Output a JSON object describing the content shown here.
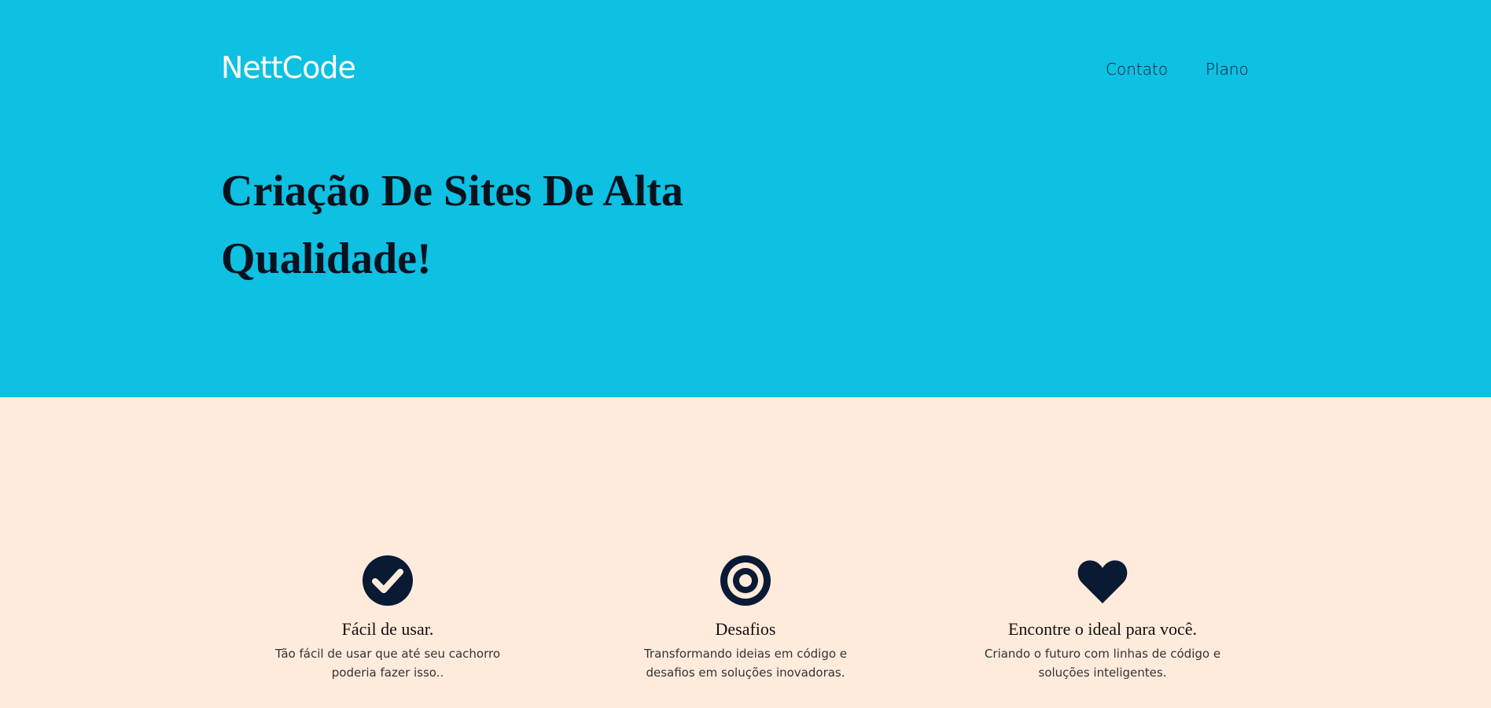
{
  "brand": {
    "name": "NettCode"
  },
  "nav": {
    "items": [
      "Contato",
      "Plano"
    ]
  },
  "hero": {
    "headline": "Criação De Sites De Alta Qualidade!"
  },
  "features": [
    {
      "icon": "check-circle-icon",
      "title": "Fácil de usar.",
      "text": "Tão fácil de usar que até seu cachorro poderia fazer isso.."
    },
    {
      "icon": "target-icon",
      "title": "Desafios",
      "text": "Transformando ideias em código e desafios em soluções inovadoras."
    },
    {
      "icon": "heart-icon",
      "title": "Encontre o ideal para você.",
      "text": "Criando o futuro com linhas de código e soluções inteligentes."
    }
  ],
  "colors": {
    "hero_bg": "#0EC0E1",
    "page_bg": "#FFEBDC",
    "icon": "#0A1A33"
  }
}
